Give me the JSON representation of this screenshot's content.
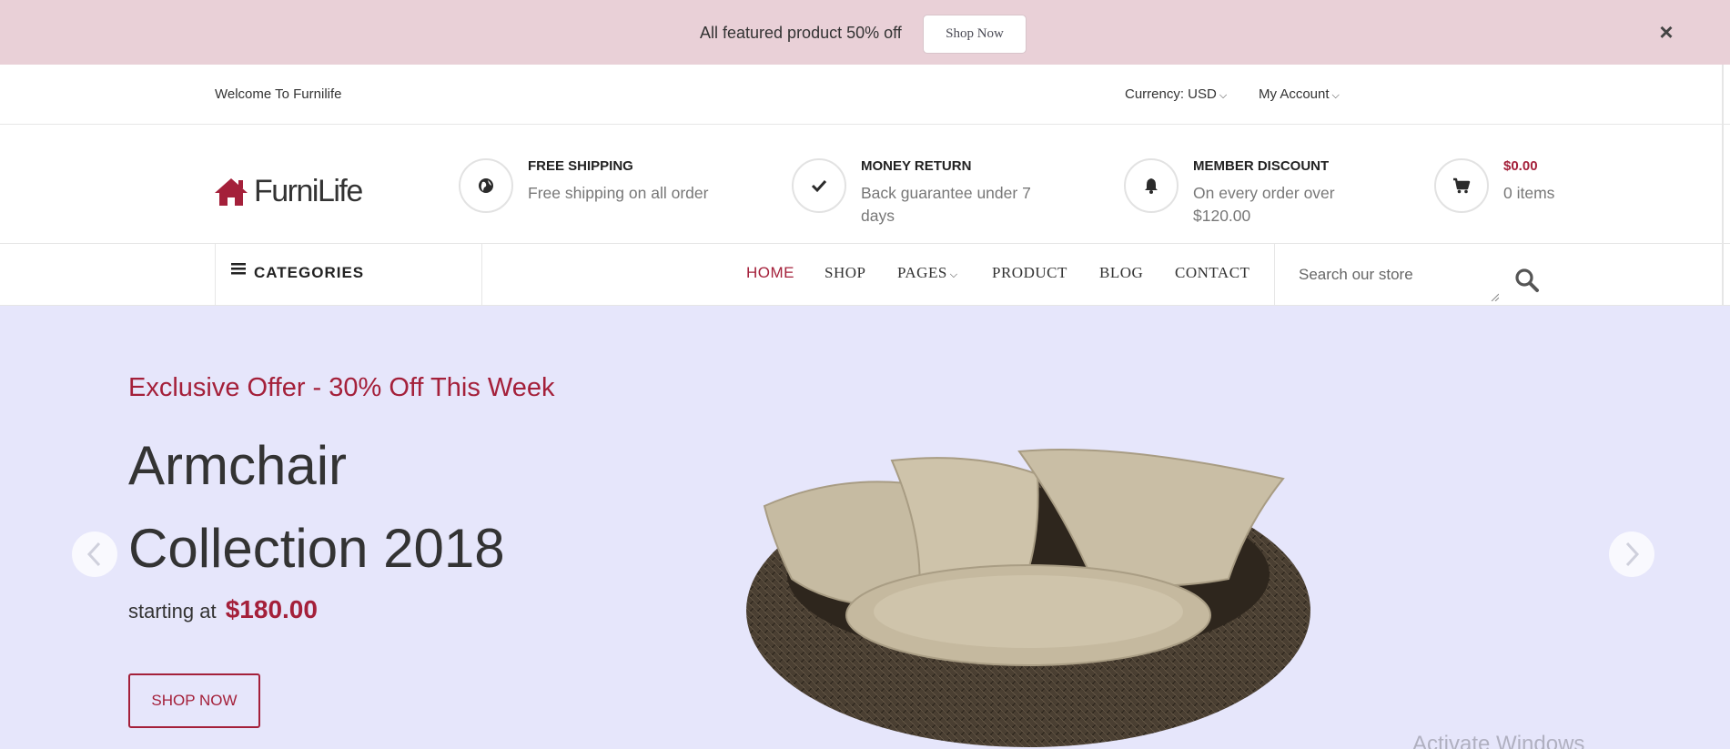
{
  "promo": {
    "text": "All featured product 50% off",
    "button_label": "Shop Now",
    "close_glyph": "×"
  },
  "topbar": {
    "welcome": "Welcome To Furnilife",
    "currency_label": "Currency: USD",
    "account_label": "My Account"
  },
  "header": {
    "logo_text": "FurniLife",
    "features": [
      {
        "icon": "globe-icon",
        "title": "FREE SHIPPING",
        "desc": "Free shipping on all order"
      },
      {
        "icon": "check-icon",
        "title": "MONEY RETURN",
        "desc": "Back guarantee under 7 days"
      },
      {
        "icon": "bell-icon",
        "title": "MEMBER DISCOUNT",
        "desc": "On every order over $120.00"
      }
    ],
    "cart": {
      "icon": "cart-icon",
      "amount": "$0.00",
      "items": "0 items"
    }
  },
  "nav": {
    "categories_label": "CATEGORIES",
    "items": [
      "HOME",
      "SHOP",
      "PAGES",
      "PRODUCT",
      "BLOG",
      "CONTACT"
    ],
    "active": "HOME",
    "search_placeholder": "Search our store"
  },
  "hero": {
    "offer": "Exclusive Offer - 30% Off This Week",
    "title_line1": "Armchair",
    "title_line2": "Collection 2018",
    "starting_text": "starting at",
    "price": "$180.00",
    "button_label": "SHOP NOW"
  },
  "watermark": "Activate Windows",
  "colors": {
    "accent": "#a4203a",
    "promo_bg": "#e9d0d7",
    "hero_bg": "#e6e6fb"
  }
}
